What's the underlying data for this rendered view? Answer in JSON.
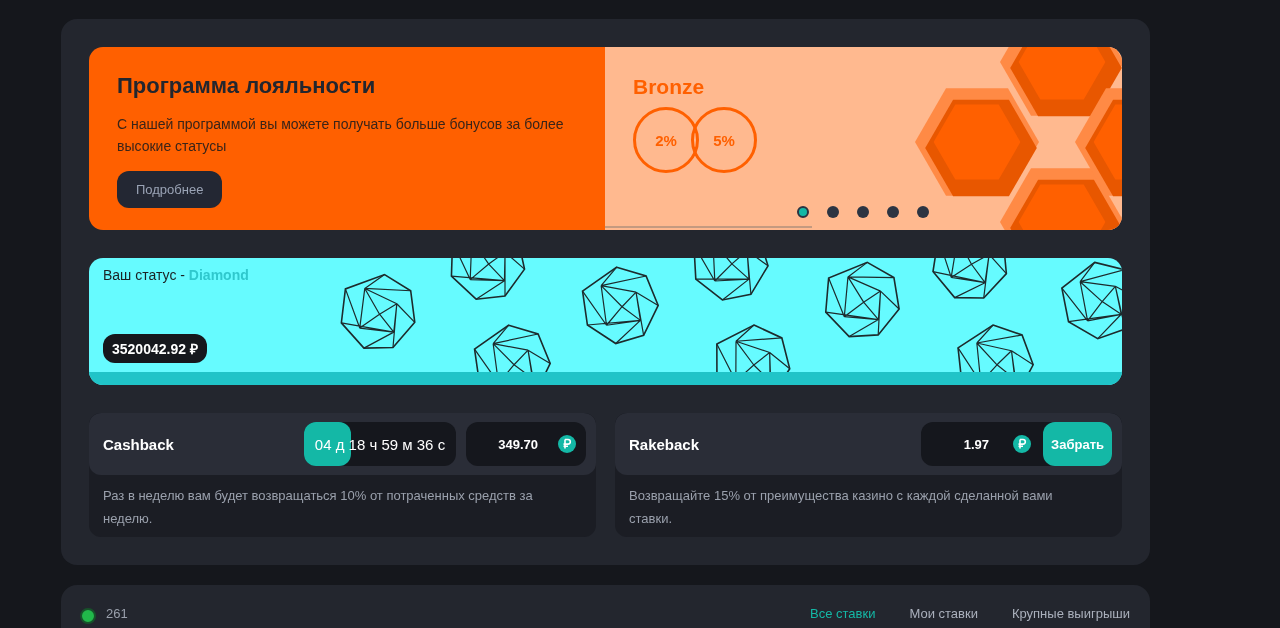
{
  "banner": {
    "title": "Программа лояльности",
    "description": "С нашей программой вы можете получать больше бонусов за более высокие статусы",
    "button": "Подробнее",
    "tier": {
      "name": "Bronze",
      "percents": [
        "2%",
        "5%"
      ]
    },
    "slides": [
      {
        "selected": true
      },
      {
        "selected": false
      },
      {
        "selected": false
      },
      {
        "selected": false
      },
      {
        "selected": false
      }
    ],
    "slide_progress": {
      "level": 0.4
    }
  },
  "status": {
    "label": "Ваш статус - ",
    "tier": "Diamond",
    "balance": "3520042.92 ₽"
  },
  "rewards": [
    {
      "kind": "timer",
      "title": "Cashback",
      "timer": "04 д 18 ч 59 м 36 с",
      "timer_progress": {
        "level": 0.31
      },
      "amount": "349.70",
      "description": "Раз в неделю вам будет возвращаться 10% от потраченных средств за неделю."
    },
    {
      "kind": "claim",
      "title": "Rakeback",
      "amount": "1.97",
      "button": "Забрать",
      "description": "Возвращайте 15% от преимущества казино с каждой сделанной вами ставки."
    }
  ],
  "bets": {
    "online": "261",
    "tabs": [
      {
        "label": "Все ставки",
        "selected": true
      },
      {
        "label": "Мои ставки",
        "selected": false
      },
      {
        "label": "Крупные выигрыши",
        "selected": false
      }
    ]
  }
}
